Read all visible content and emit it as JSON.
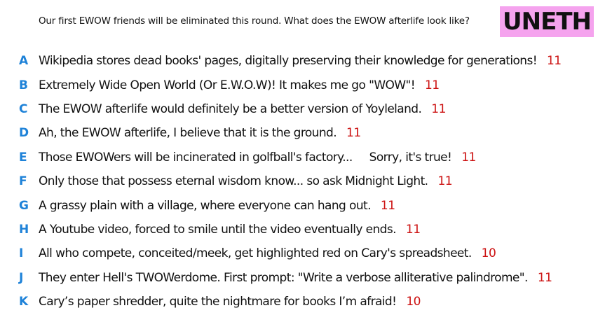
{
  "prompt": "Our first EWOW friends will be eliminated this round. What does the EWOW afterlife look like?",
  "badge": {
    "label": "UNETH",
    "color": "#f5a3ee"
  },
  "colors": {
    "letter": "#1e82d8",
    "count": "#cc1111",
    "text": "#111111"
  },
  "responses": [
    {
      "letter": "A",
      "text": "Wikipedia stores dead books' pages, digitally preserving their knowledge for generations!",
      "count": "11"
    },
    {
      "letter": "B",
      "text": "Extremely Wide Open World (Or E.W.O.W)! It makes me go \"WOW\"!",
      "count": "11"
    },
    {
      "letter": "C",
      "text": "The EWOW afterlife would definitely be a better version of Yoyleland.",
      "count": "11"
    },
    {
      "letter": "D",
      "text": "Ah, the EWOW afterlife, I believe that it is the ground.",
      "count": "11"
    },
    {
      "letter": "E",
      "text": "Those EWOWers will be incinerated in golfball's factory...     Sorry, it's true!",
      "count": "11"
    },
    {
      "letter": "F",
      "text": "Only those that possess eternal wisdom know... so ask Midnight Light.",
      "count": "11"
    },
    {
      "letter": "G",
      "text": "A grassy plain with a village, where everyone can hang out.",
      "count": "11"
    },
    {
      "letter": "H",
      "text": "A Youtube video, forced to smile until the video eventually ends.",
      "count": "11"
    },
    {
      "letter": "I",
      "text": "All who compete, conceited/meek, get highlighted red on Cary's spreadsheet.",
      "count": "10"
    },
    {
      "letter": "J",
      "text": "They enter Hell's TWOWerdome. First prompt: \"Write a verbose alliterative palindrome\".",
      "count": "11"
    },
    {
      "letter": "K",
      "text": "Cary’s paper shredder, quite the nightmare for books I’m afraid!",
      "count": "10"
    }
  ]
}
